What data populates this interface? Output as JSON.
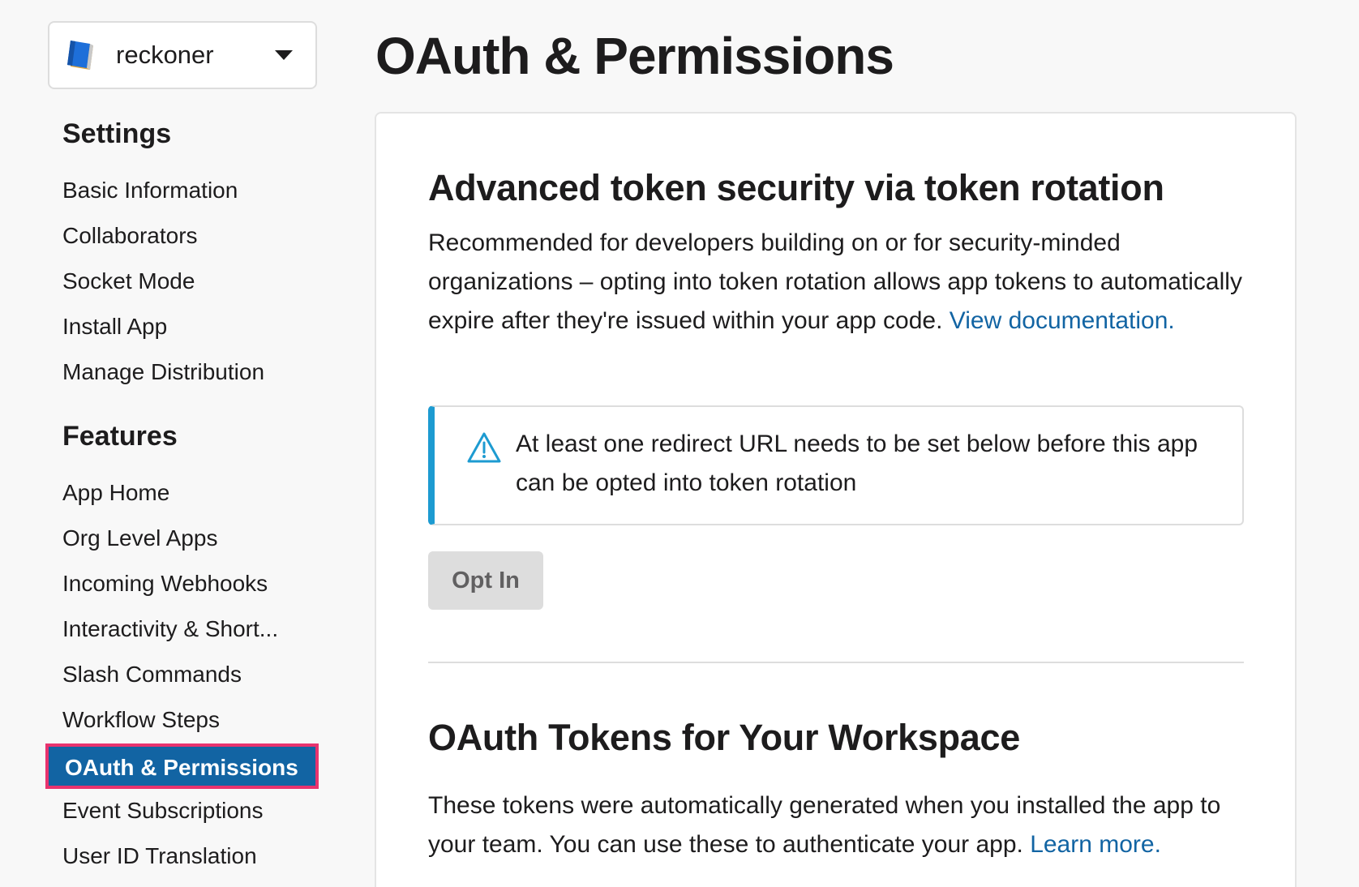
{
  "app": {
    "name": "reckoner"
  },
  "sidebar": {
    "settings_title": "Settings",
    "settings_items": [
      "Basic Information",
      "Collaborators",
      "Socket Mode",
      "Install App",
      "Manage Distribution"
    ],
    "features_title": "Features",
    "features_items": [
      "App Home",
      "Org Level Apps",
      "Incoming Webhooks",
      "Interactivity & Short...",
      "Slash Commands",
      "Workflow Steps",
      "OAuth & Permissions",
      "Event Subscriptions",
      "User ID Translation"
    ],
    "active_item": "OAuth & Permissions"
  },
  "main": {
    "page_title": "OAuth & Permissions",
    "rotation": {
      "heading": "Advanced token security via token rotation",
      "description": "Recommended for developers building on or for security-minded organizations – opting into token rotation allows app tokens to automatically expire after they're issued within your app code.",
      "link_text": "View documentation.",
      "callout_text": "At least one redirect URL needs to be set below before this app can be opted into token rotation",
      "button_label": "Opt In"
    },
    "tokens": {
      "heading": "OAuth Tokens for Your Workspace",
      "description": "These tokens were automatically generated when you installed the app to your team. You can use these to authenticate your app.",
      "link_text": "Learn more."
    }
  },
  "colors": {
    "accent": "#1264a3",
    "highlight_border": "#e8336e",
    "callout_accent": "#1d9bd1"
  },
  "icons": {
    "app_logo": "book-icon",
    "dropdown": "caret-down-icon",
    "callout": "warning-triangle-icon"
  }
}
